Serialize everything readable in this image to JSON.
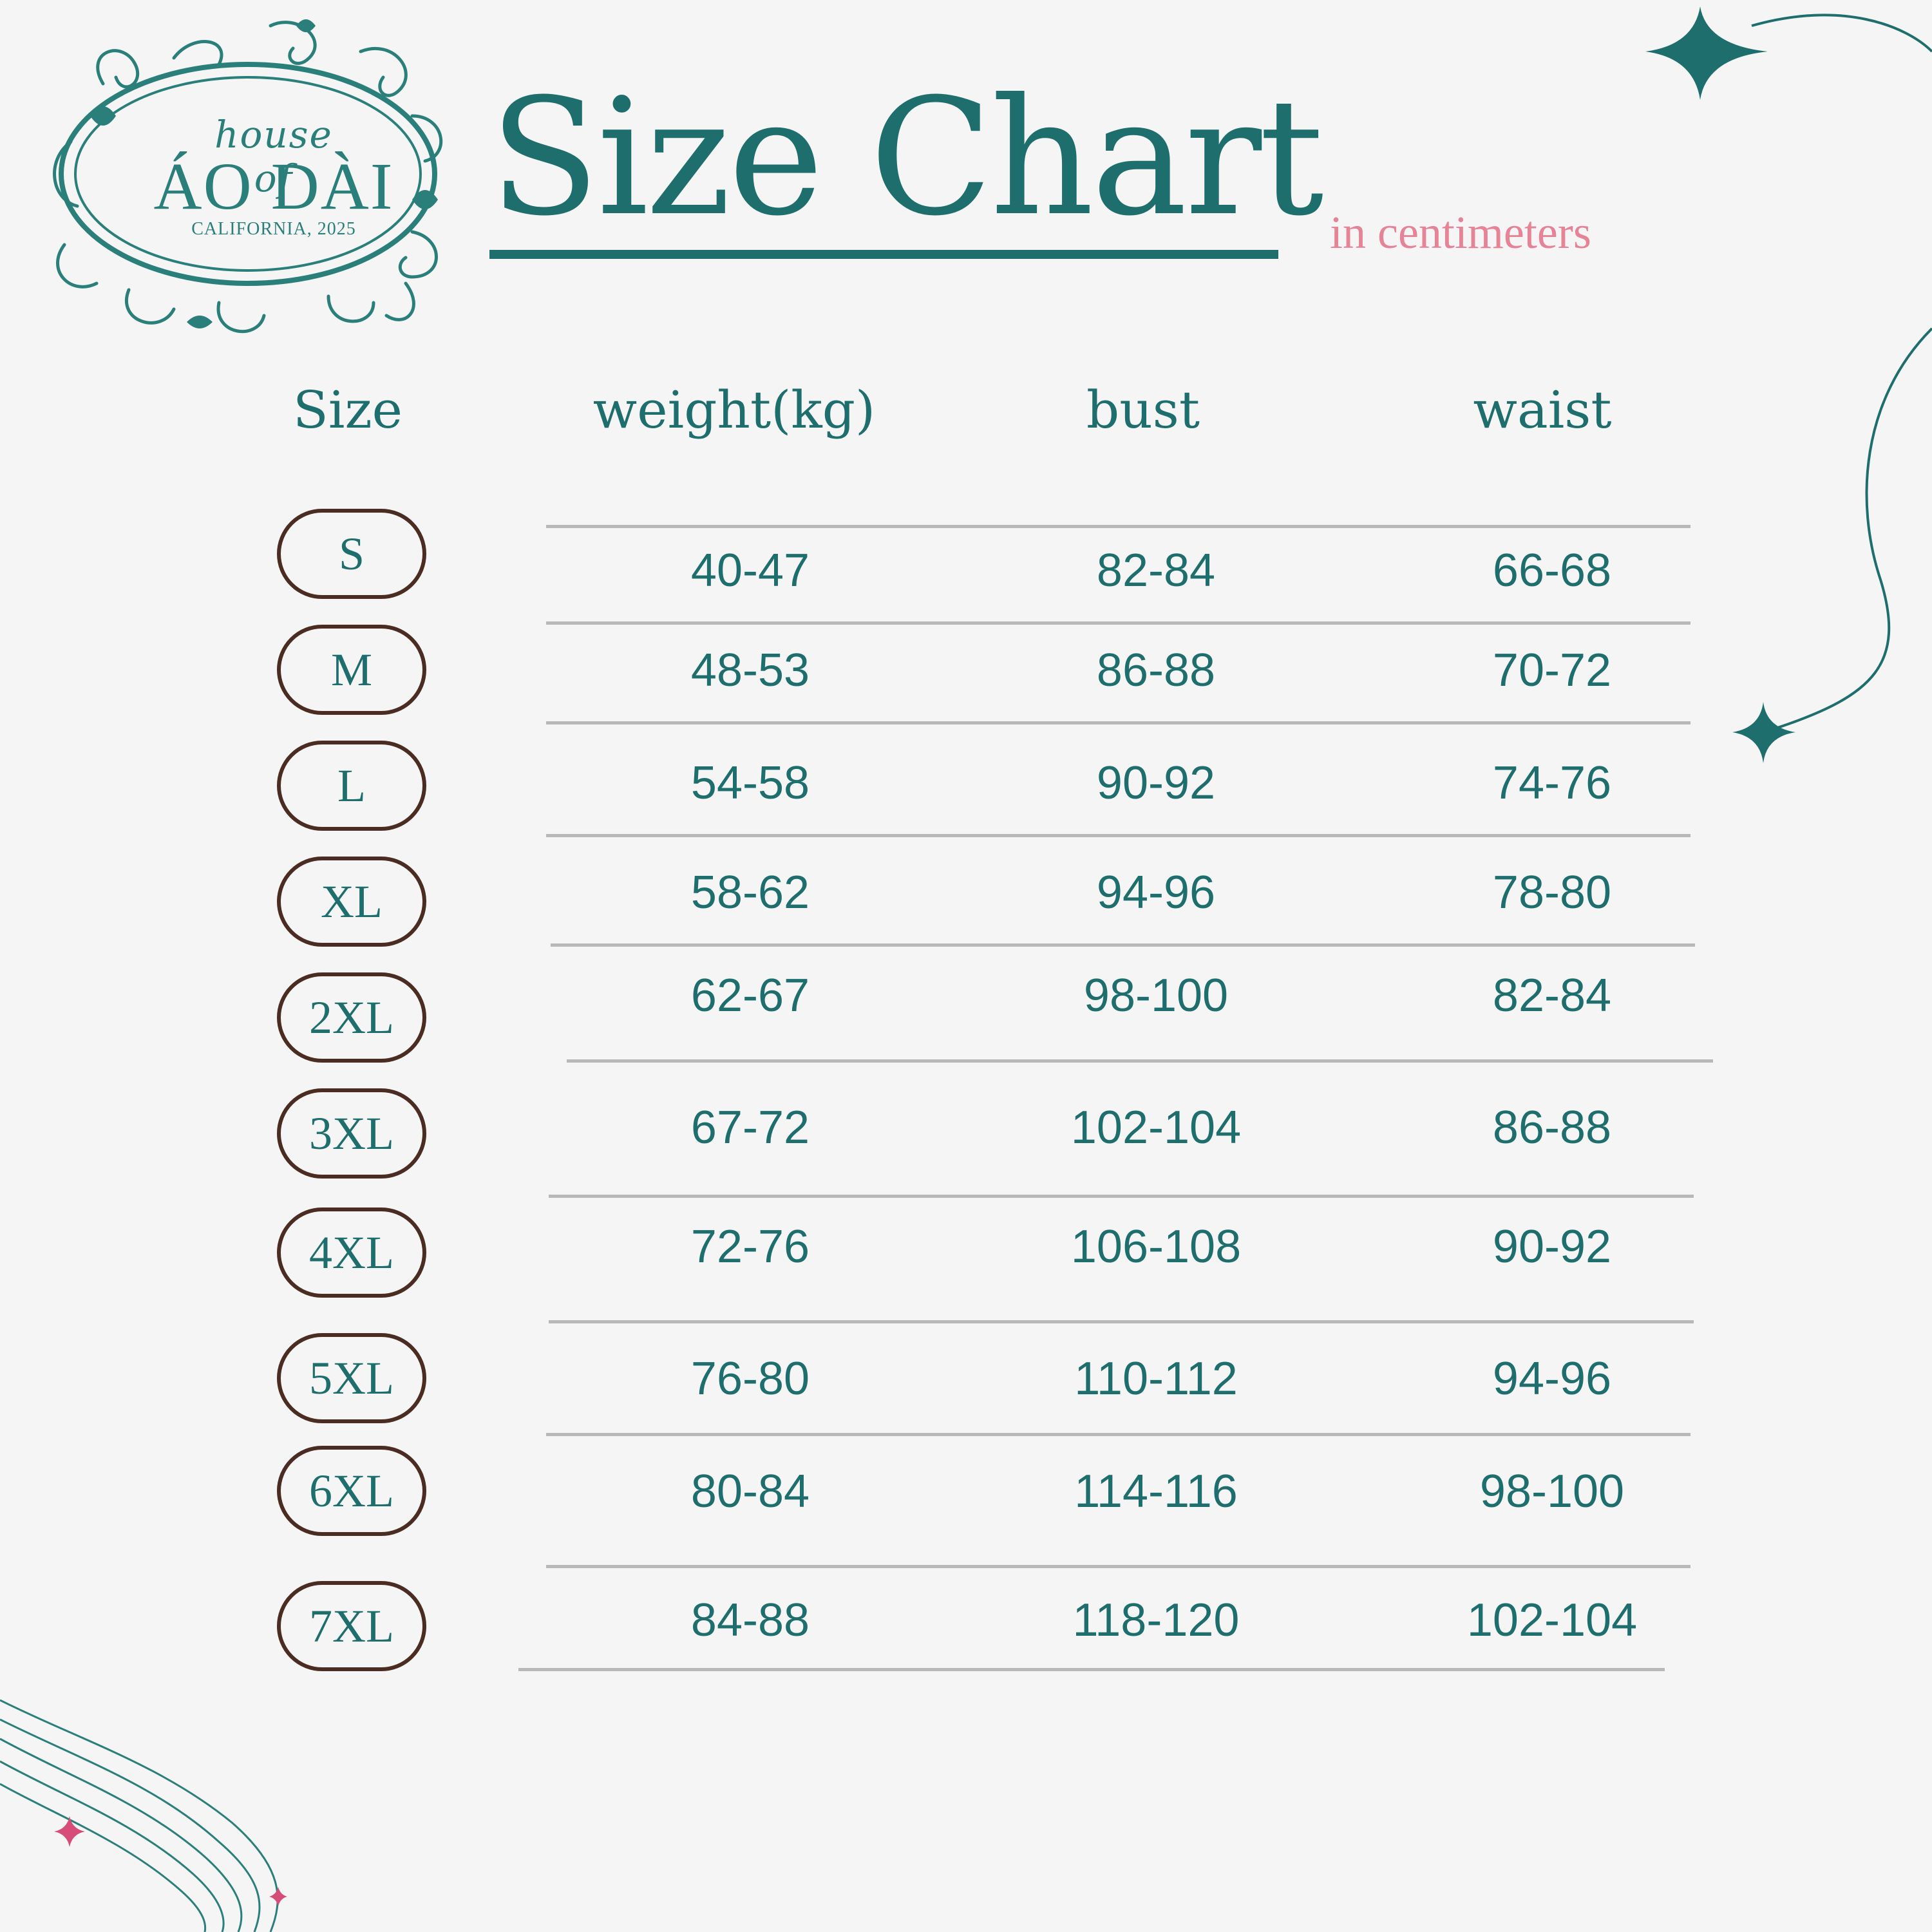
{
  "logo": {
    "top_line": "house of",
    "brand": "ÁO DÀI",
    "sub": "CALIFORNIA, 2025"
  },
  "title": "Size Chart",
  "subtitle": "in centimeters",
  "headers": {
    "size": "Size",
    "weight": "weight(kg)",
    "bust": "bust",
    "waist": "waist"
  },
  "rows": [
    {
      "size": "S",
      "weight": "40-47",
      "bust": "82-84",
      "waist": "66-68"
    },
    {
      "size": "M",
      "weight": "48-53",
      "bust": "86-88",
      "waist": "70-72"
    },
    {
      "size": "L",
      "weight": "54-58",
      "bust": "90-92",
      "waist": "74-76"
    },
    {
      "size": "XL",
      "weight": "58-62",
      "bust": "94-96",
      "waist": "78-80"
    },
    {
      "size": "2XL",
      "weight": "62-67",
      "bust": "98-100",
      "waist": "82-84"
    },
    {
      "size": "3XL",
      "weight": "67-72",
      "bust": "102-104",
      "waist": "86-88"
    },
    {
      "size": "4XL",
      "weight": "72-76",
      "bust": "106-108",
      "waist": "90-92"
    },
    {
      "size": "5XL",
      "weight": "76-80",
      "bust": "110-112",
      "waist": "94-96"
    },
    {
      "size": "6XL",
      "weight": "80-84",
      "bust": "114-116",
      "waist": "98-100"
    },
    {
      "size": "7XL",
      "weight": "84-88",
      "bust": "118-120",
      "waist": "102-104"
    }
  ],
  "colors": {
    "teal": "#1f6e6e",
    "pink": "#e58496",
    "pill_border": "#4a2c22",
    "rule": "#b8b8b8",
    "background": "#f5f5f5"
  }
}
